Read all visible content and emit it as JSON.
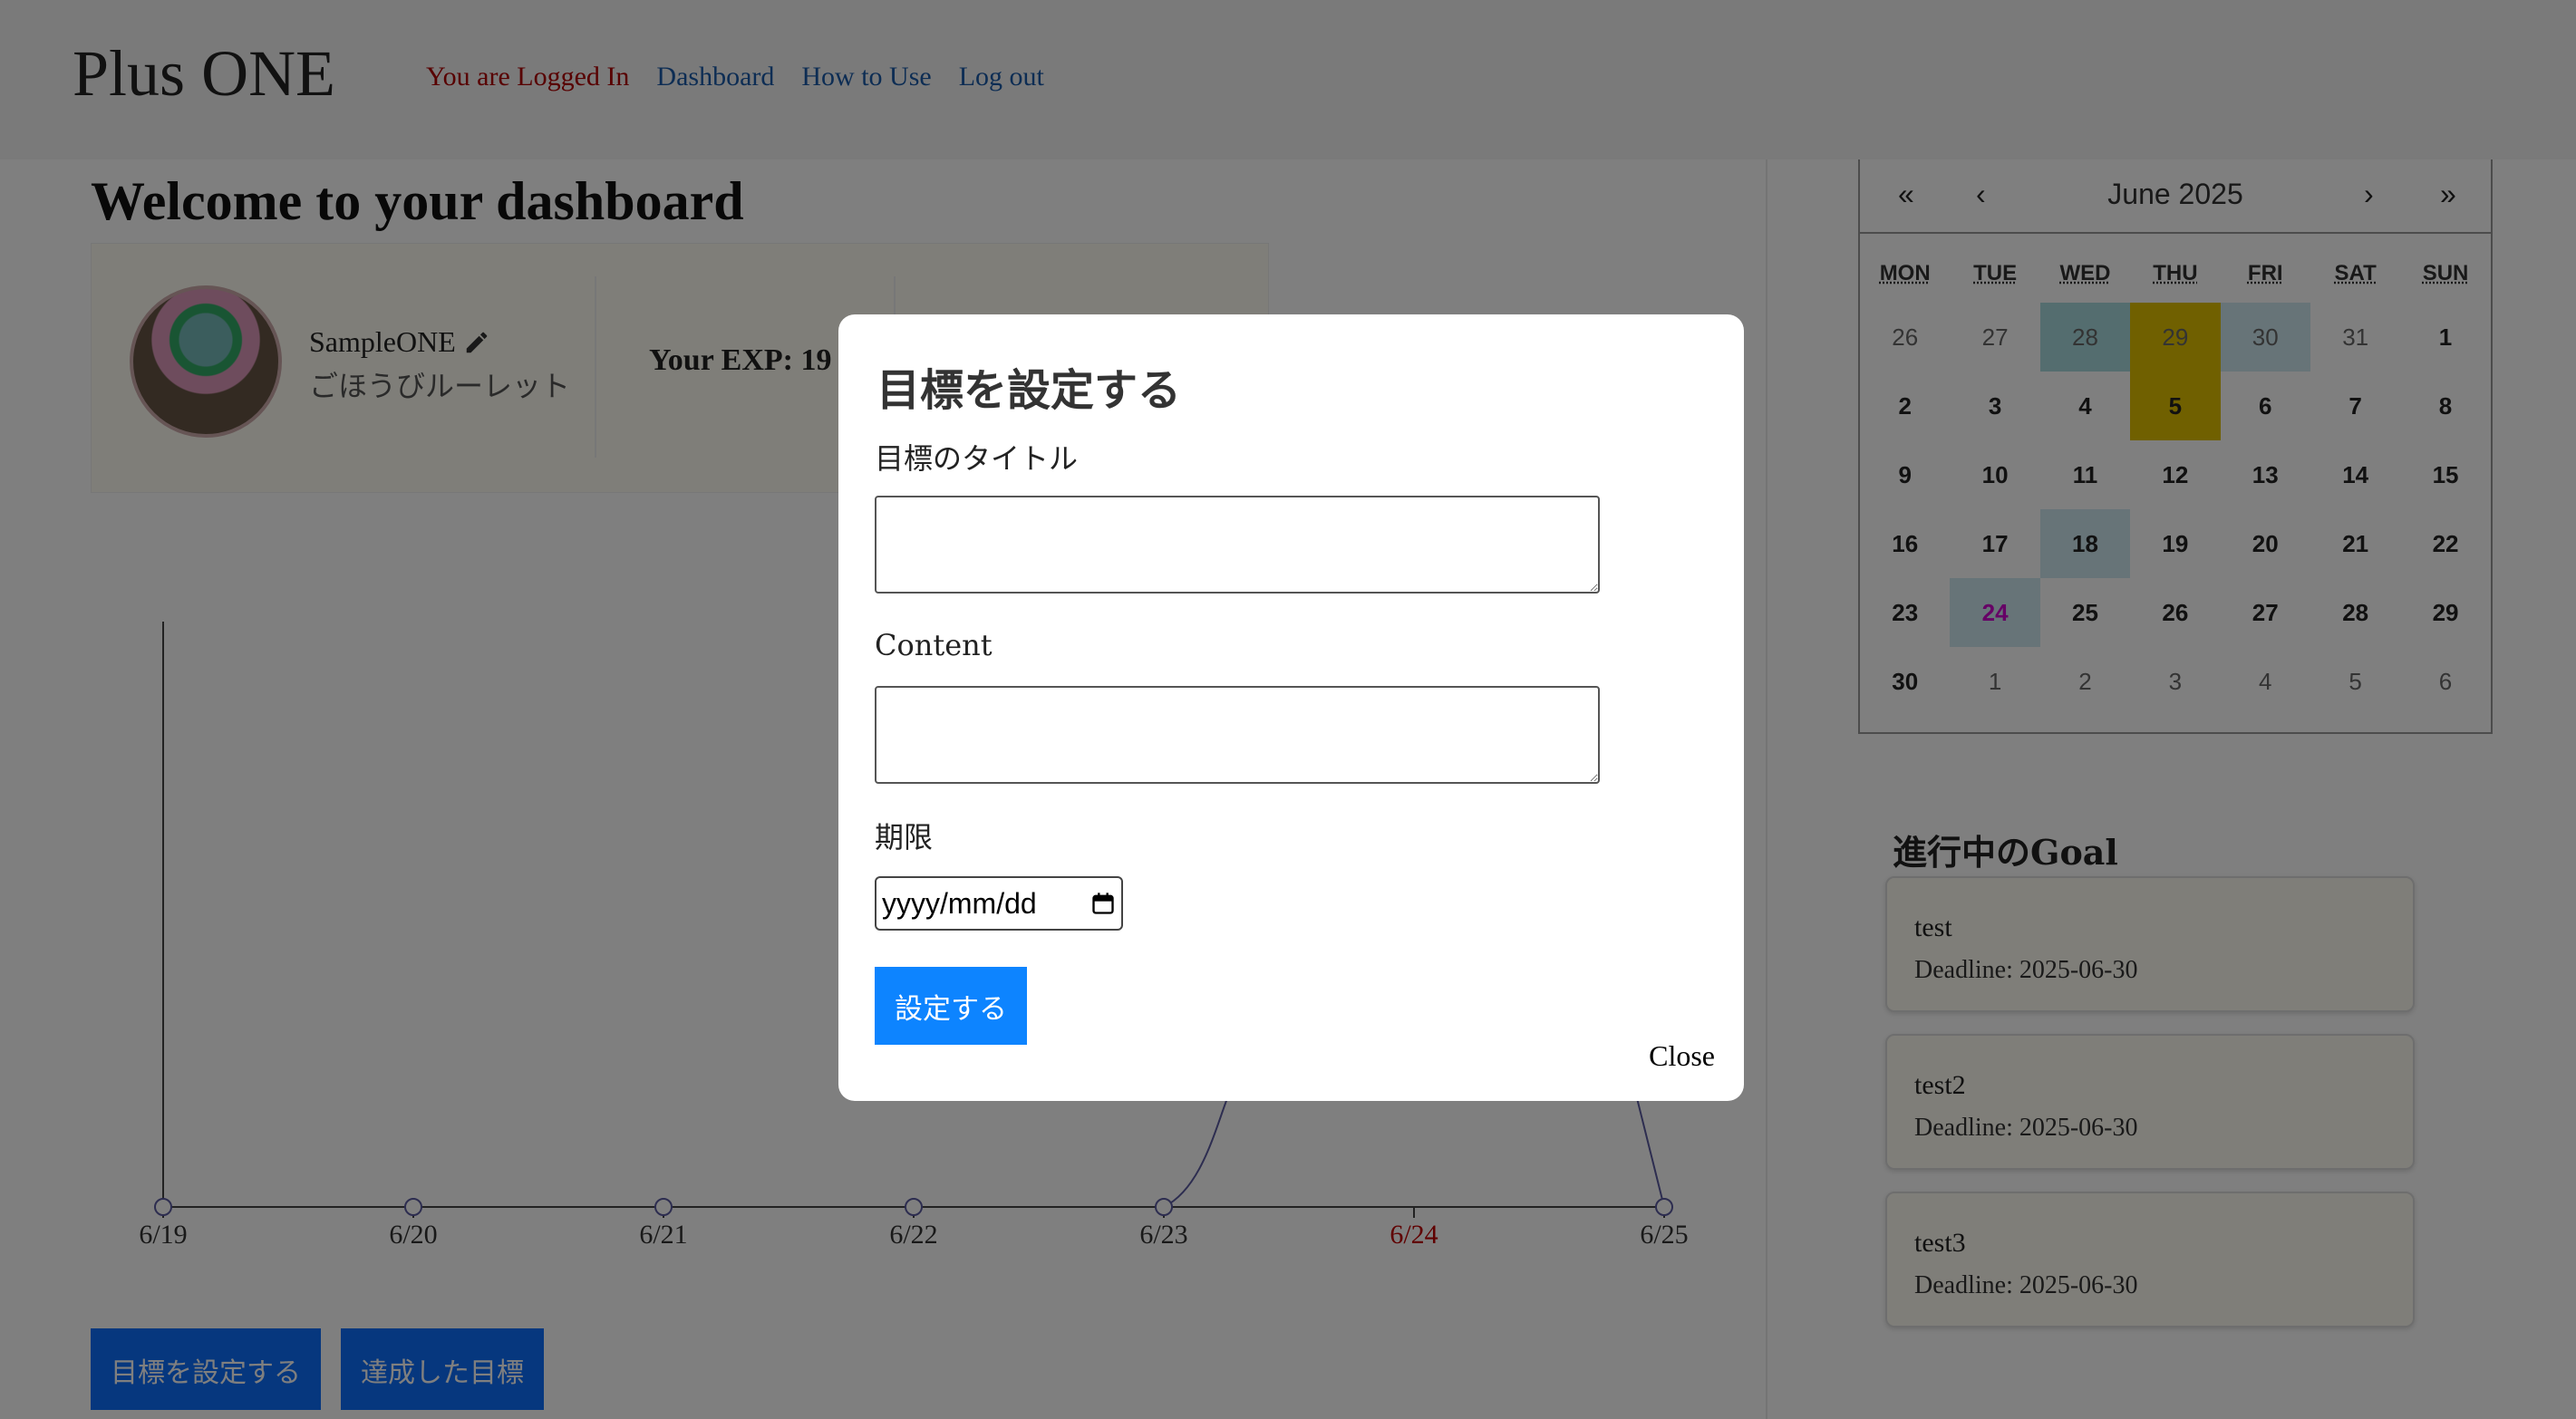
{
  "header": {
    "brand": "Plus ONE",
    "logged_in": "You are Logged In",
    "nav": [
      "Dashboard",
      "How to Use",
      "Log out"
    ]
  },
  "main": {
    "welcome": "Welcome to your dashboard",
    "profile": {
      "name": "SampleONE",
      "roulette": "ごほうびルーレット",
      "exp": "Your EXP: 19"
    },
    "buttons": {
      "set_goal": "目標を設定する",
      "achieved": "達成した目標"
    }
  },
  "chart_data": {
    "type": "line",
    "x": [
      "6/19",
      "6/20",
      "6/21",
      "6/22",
      "6/23",
      "6/24",
      "6/25"
    ],
    "highlight_x": "6/24",
    "highlight_color": "#c00000",
    "line_color": "#5a5aa0",
    "grid": false
  },
  "calendar": {
    "title": "June 2025",
    "nav": {
      "first": "«",
      "prev": "‹",
      "next": "›",
      "last": "»"
    },
    "weekdays": [
      "MON",
      "TUE",
      "WED",
      "THU",
      "FRI",
      "SAT",
      "SUN"
    ],
    "weeks": [
      [
        "26",
        "27",
        "28",
        "29",
        "30",
        "31",
        "1"
      ],
      [
        "2",
        "3",
        "4",
        "5",
        "6",
        "7",
        "8"
      ],
      [
        "9",
        "10",
        "11",
        "12",
        "13",
        "14",
        "15"
      ],
      [
        "16",
        "17",
        "18",
        "19",
        "20",
        "21",
        "22"
      ],
      [
        "23",
        "24",
        "25",
        "26",
        "27",
        "28",
        "29"
      ],
      [
        "30",
        "1",
        "2",
        "3",
        "4",
        "5",
        "6"
      ]
    ]
  },
  "goals": {
    "title": "進行中のGoal",
    "items": [
      {
        "title": "test",
        "deadline": "Deadline: 2025-06-30"
      },
      {
        "title": "test2",
        "deadline": "Deadline: 2025-06-30"
      },
      {
        "title": "test3",
        "deadline": "Deadline: 2025-06-30"
      }
    ]
  },
  "modal": {
    "title": "目標を設定する",
    "title_label": "目標のタイトル",
    "content_label": "Content",
    "deadline_label": "期限",
    "date_placeholder": "yyyy/mm/dd",
    "submit": "設定する",
    "close": "Close"
  },
  "colors": {
    "primary_button": "#0d6efd",
    "modal_submit": "#0d84ff",
    "today_highlight": "#e0c000",
    "goal_day": "#a8dadf"
  }
}
